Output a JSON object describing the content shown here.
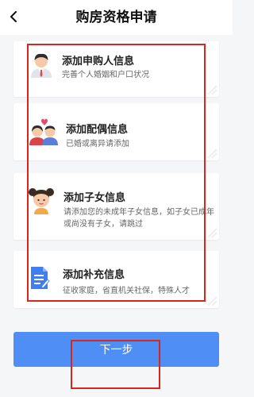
{
  "header": {
    "title": "购房资格申请",
    "back_icon": "chevron-left-icon"
  },
  "cards": [
    {
      "title": "添加申购人信息",
      "desc": "完善个人婚姻和户口状况",
      "icon": "applicant-icon"
    },
    {
      "title": "添加配偶信息",
      "desc": "已婚或离异请添加",
      "icon": "spouse-icon"
    },
    {
      "title": "添加子女信息",
      "desc": "请添加您的未成年子女信息，如子女已成年或尚没有子女，请跳过",
      "icon": "child-icon"
    },
    {
      "title": "添加补充信息",
      "desc": "征收家庭，省直机关社保，特殊人才",
      "icon": "document-icon"
    }
  ],
  "footer": {
    "next_label": "下一步"
  },
  "colors": {
    "accent": "#4e8ef5",
    "highlight": "#d9261c"
  }
}
